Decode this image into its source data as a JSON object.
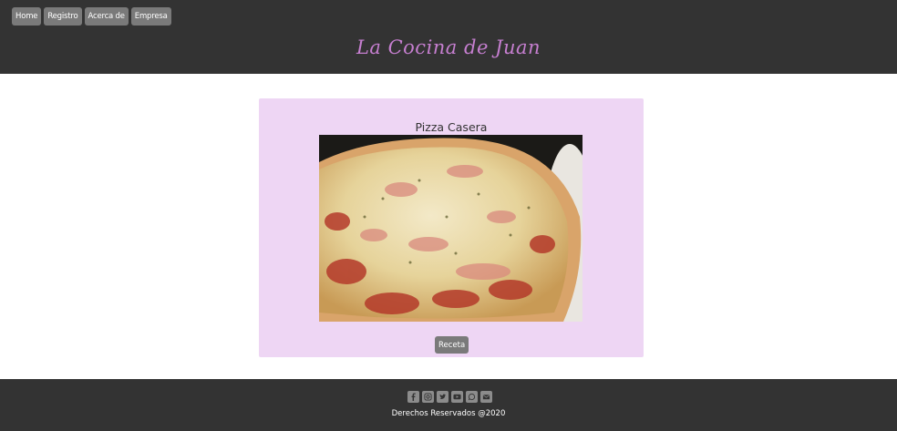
{
  "nav": {
    "items": [
      {
        "label": "Home"
      },
      {
        "label": "Registro"
      },
      {
        "label": "Acerca de"
      },
      {
        "label": "Empresa"
      }
    ]
  },
  "header": {
    "brand": "La Cocina de Juan",
    "brand_color": "#c67fd0"
  },
  "card": {
    "title": "Pizza Casera",
    "image_alt": "pizza-photo",
    "button_label": "Receta",
    "background": "#eed6f4"
  },
  "footer": {
    "socials": [
      "facebook-icon",
      "instagram-icon",
      "twitter-icon",
      "youtube-icon",
      "whatsapp-icon",
      "email-icon"
    ],
    "copyright": "Derechos Reservados @2020"
  }
}
